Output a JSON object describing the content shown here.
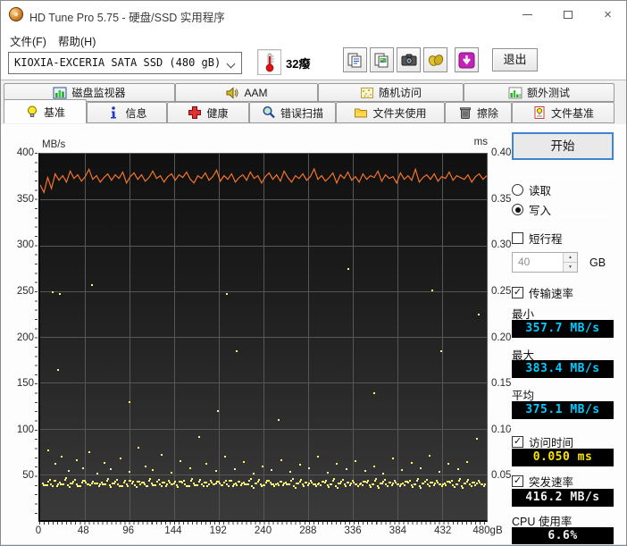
{
  "window": {
    "title": "HD Tune Pro 5.75 - 硬盘/SSD 实用程序"
  },
  "menu": {
    "file": "文件(F)",
    "help": "帮助(H)"
  },
  "toolbar": {
    "drive_select": "KIOXIA-EXCERIA SATA SSD (480 gB)",
    "temperature": "32癈",
    "exit_label": "退出"
  },
  "tabs_back": [
    {
      "label": "磁盘监视器"
    },
    {
      "label": "AAM"
    },
    {
      "label": "随机访问"
    },
    {
      "label": "额外测试"
    }
  ],
  "tabs_front": [
    {
      "label": "基准",
      "selected": true
    },
    {
      "label": "信息"
    },
    {
      "label": "健康"
    },
    {
      "label": "错误扫描"
    },
    {
      "label": "文件夹使用"
    },
    {
      "label": "擦除"
    },
    {
      "label": "文件基准"
    }
  ],
  "panel": {
    "start_label": "开始",
    "read_label": "读取",
    "write_label": "写入",
    "selected_mode": "写入",
    "short_stroke_label": "短行程",
    "short_stroke_value": "40",
    "short_stroke_unit": "GB",
    "transfer_label": "传输速率",
    "min_label": "最小",
    "min_value": "357.7 MB/s",
    "max_label": "最大",
    "max_value": "383.4 MB/s",
    "avg_label": "平均",
    "avg_value": "375.1 MB/s",
    "access_label": "访问时间",
    "access_value": "0.050 ms",
    "burst_label": "突发速率",
    "burst_value": "416.2 MB/s",
    "cpu_label": "CPU 使用率",
    "cpu_value": "6.6%"
  },
  "chart_data": {
    "type": "line+scatter",
    "ylabel_left": "MB/s",
    "ylabel_right": "ms",
    "ylim_left": [
      0,
      400
    ],
    "ylim_right": [
      0,
      0.4
    ],
    "xlim": [
      0,
      480
    ],
    "yticks_left": [
      400,
      350,
      300,
      250,
      200,
      150,
      100,
      50
    ],
    "yticks_right": [
      "0.40",
      "0.35",
      "0.30",
      "0.25",
      "0.20",
      "0.15",
      "0.10",
      "0.05"
    ],
    "xtick_values": [
      0,
      48,
      96,
      144,
      192,
      240,
      288,
      336,
      384,
      432,
      480
    ],
    "xtick_labels": [
      "0",
      "48",
      "96",
      "144",
      "192",
      "240",
      "288",
      "336",
      "384",
      "432",
      "480gB"
    ],
    "grid": true,
    "colors": {
      "transfer_line": "#f4742b",
      "access_dot": "#ffff55",
      "access_dot_alt": "#f6efa0",
      "grid": "#575757"
    },
    "series": [
      {
        "name": "transfer-rate-write",
        "unit": "MB/s",
        "axis": "left",
        "x_range": [
          0,
          480
        ],
        "values": [
          366,
          357.7,
          374,
          362,
          378,
          371,
          376,
          369,
          381,
          373,
          377,
          370,
          375,
          383,
          372,
          376,
          369,
          374,
          378,
          371,
          377,
          373,
          380,
          368,
          375,
          379,
          372,
          377,
          370,
          374,
          381,
          373,
          376,
          369,
          375,
          378,
          371,
          377,
          374,
          380,
          372,
          368,
          376,
          373,
          379,
          371,
          375,
          382,
          370,
          376,
          372,
          378,
          369,
          374,
          377,
          371,
          380,
          373,
          376,
          368,
          375,
          379,
          372,
          377,
          370,
          381,
          374,
          369,
          376,
          373,
          378,
          371,
          375,
          383.4,
          372,
          376,
          370,
          374,
          379,
          368,
          377,
          373,
          380,
          371,
          375,
          369,
          378,
          372,
          376,
          374,
          381,
          370,
          377,
          373,
          375,
          368,
          379,
          372,
          376,
          371,
          383,
          369,
          374,
          377,
          372,
          378,
          370,
          375,
          373,
          380,
          371,
          376,
          374,
          372,
          377,
          369,
          375,
          378,
          372,
          376
        ]
      },
      {
        "name": "access-time",
        "unit": "ms",
        "axis": "right",
        "note": "y stored as ms*1000 so it maps onto the left 0-400 scale",
        "points": [
          [
            2,
            41
          ],
          [
            5,
            39
          ],
          [
            8,
            43
          ],
          [
            11,
            40
          ],
          [
            14,
            44
          ],
          [
            17,
            38
          ],
          [
            20,
            42
          ],
          [
            23,
            40
          ],
          [
            26,
            45
          ],
          [
            29,
            39
          ],
          [
            32,
            41
          ],
          [
            35,
            43
          ],
          [
            38,
            40
          ],
          [
            41,
            38
          ],
          [
            44,
            42
          ],
          [
            47,
            44
          ],
          [
            50,
            40
          ],
          [
            53,
            39
          ],
          [
            56,
            43
          ],
          [
            59,
            41
          ],
          [
            62,
            38
          ],
          [
            65,
            42
          ],
          [
            68,
            40
          ],
          [
            71,
            44
          ],
          [
            74,
            39
          ],
          [
            77,
            41
          ],
          [
            80,
            43
          ],
          [
            83,
            40
          ],
          [
            86,
            38
          ],
          [
            89,
            42
          ],
          [
            92,
            40
          ],
          [
            95,
            44
          ],
          [
            98,
            41
          ],
          [
            101,
            39
          ],
          [
            104,
            43
          ],
          [
            107,
            40
          ],
          [
            110,
            42
          ],
          [
            113,
            38
          ],
          [
            116,
            44
          ],
          [
            119,
            41
          ],
          [
            122,
            39
          ],
          [
            125,
            43
          ],
          [
            128,
            40
          ],
          [
            131,
            42
          ],
          [
            134,
            38
          ],
          [
            137,
            44
          ],
          [
            140,
            40
          ],
          [
            143,
            41
          ],
          [
            146,
            39
          ],
          [
            149,
            43
          ],
          [
            152,
            42
          ],
          [
            155,
            40
          ],
          [
            158,
            38
          ],
          [
            161,
            44
          ],
          [
            164,
            41
          ],
          [
            167,
            39
          ],
          [
            170,
            43
          ],
          [
            173,
            40
          ],
          [
            176,
            42
          ],
          [
            179,
            38
          ],
          [
            182,
            44
          ],
          [
            185,
            40
          ],
          [
            188,
            41
          ],
          [
            191,
            43
          ],
          [
            194,
            39
          ],
          [
            197,
            42
          ],
          [
            200,
            40
          ],
          [
            203,
            44
          ],
          [
            206,
            38
          ],
          [
            209,
            41
          ],
          [
            212,
            43
          ],
          [
            215,
            39
          ],
          [
            218,
            42
          ],
          [
            221,
            40
          ],
          [
            224,
            44
          ],
          [
            227,
            38
          ],
          [
            230,
            41
          ],
          [
            233,
            43
          ],
          [
            236,
            40
          ],
          [
            239,
            39
          ],
          [
            242,
            42
          ],
          [
            245,
            44
          ],
          [
            248,
            40
          ],
          [
            251,
            38
          ],
          [
            254,
            41
          ],
          [
            257,
            43
          ],
          [
            260,
            39
          ],
          [
            263,
            42
          ],
          [
            266,
            40
          ],
          [
            269,
            44
          ],
          [
            272,
            38
          ],
          [
            275,
            41
          ],
          [
            278,
            43
          ],
          [
            281,
            40
          ],
          [
            284,
            42
          ],
          [
            287,
            39
          ],
          [
            290,
            44
          ],
          [
            293,
            40
          ],
          [
            296,
            38
          ],
          [
            299,
            41
          ],
          [
            302,
            43
          ],
          [
            305,
            42
          ],
          [
            308,
            39
          ],
          [
            311,
            40
          ],
          [
            314,
            44
          ],
          [
            317,
            38
          ],
          [
            320,
            41
          ],
          [
            323,
            43
          ],
          [
            326,
            40
          ],
          [
            329,
            42
          ],
          [
            332,
            39
          ],
          [
            335,
            44
          ],
          [
            338,
            40
          ],
          [
            341,
            38
          ],
          [
            344,
            41
          ],
          [
            347,
            43
          ],
          [
            350,
            42
          ],
          [
            353,
            39
          ],
          [
            356,
            40
          ],
          [
            359,
            44
          ],
          [
            362,
            38
          ],
          [
            365,
            41
          ],
          [
            368,
            43
          ],
          [
            371,
            40
          ],
          [
            374,
            42
          ],
          [
            377,
            39
          ],
          [
            380,
            44
          ],
          [
            383,
            40
          ],
          [
            386,
            38
          ],
          [
            389,
            41
          ],
          [
            392,
            43
          ],
          [
            395,
            42
          ],
          [
            398,
            39
          ],
          [
            401,
            40
          ],
          [
            404,
            44
          ],
          [
            407,
            38
          ],
          [
            410,
            41
          ],
          [
            413,
            43
          ],
          [
            416,
            40
          ],
          [
            419,
            42
          ],
          [
            422,
            39
          ],
          [
            425,
            44
          ],
          [
            428,
            40
          ],
          [
            431,
            38
          ],
          [
            434,
            41
          ],
          [
            437,
            43
          ],
          [
            440,
            42
          ],
          [
            443,
            39
          ],
          [
            446,
            40
          ],
          [
            449,
            44
          ],
          [
            452,
            38
          ],
          [
            455,
            41
          ],
          [
            458,
            43
          ],
          [
            461,
            40
          ],
          [
            464,
            42
          ],
          [
            467,
            39
          ],
          [
            470,
            44
          ],
          [
            473,
            40
          ],
          [
            476,
            38
          ],
          [
            8,
            77
          ],
          [
            15,
            62
          ],
          [
            22,
            70
          ],
          [
            30,
            55
          ],
          [
            38,
            66
          ],
          [
            45,
            58
          ],
          [
            52,
            75
          ],
          [
            60,
            52
          ],
          [
            68,
            63
          ],
          [
            75,
            57
          ],
          [
            85,
            68
          ],
          [
            95,
            54
          ],
          [
            105,
            80
          ],
          [
            112,
            60
          ],
          [
            120,
            56
          ],
          [
            130,
            72
          ],
          [
            140,
            53
          ],
          [
            150,
            65
          ],
          [
            160,
            58
          ],
          [
            170,
            92
          ],
          [
            178,
            62
          ],
          [
            188,
            55
          ],
          [
            198,
            70
          ],
          [
            208,
            57
          ],
          [
            218,
            64
          ],
          [
            228,
            52
          ],
          [
            238,
            60
          ],
          [
            248,
            56
          ],
          [
            258,
            66
          ],
          [
            268,
            54
          ],
          [
            278,
            61
          ],
          [
            288,
            58
          ],
          [
            298,
            70
          ],
          [
            308,
            53
          ],
          [
            318,
            62
          ],
          [
            328,
            57
          ],
          [
            338,
            65
          ],
          [
            348,
            55
          ],
          [
            358,
            60
          ],
          [
            368,
            52
          ],
          [
            378,
            68
          ],
          [
            388,
            56
          ],
          [
            398,
            63
          ],
          [
            408,
            58
          ],
          [
            418,
            71
          ],
          [
            428,
            54
          ],
          [
            438,
            62
          ],
          [
            448,
            57
          ],
          [
            458,
            64
          ],
          [
            468,
            90
          ],
          [
            12,
            250
          ],
          [
            20,
            248
          ],
          [
            55,
            258
          ],
          [
            18,
            165
          ],
          [
            95,
            130
          ],
          [
            200,
            248
          ],
          [
            210,
            185
          ],
          [
            190,
            120
          ],
          [
            420,
            252
          ],
          [
            430,
            185
          ],
          [
            330,
            275
          ],
          [
            470,
            225
          ],
          [
            358,
            140
          ],
          [
            255,
            110
          ]
        ]
      }
    ]
  }
}
